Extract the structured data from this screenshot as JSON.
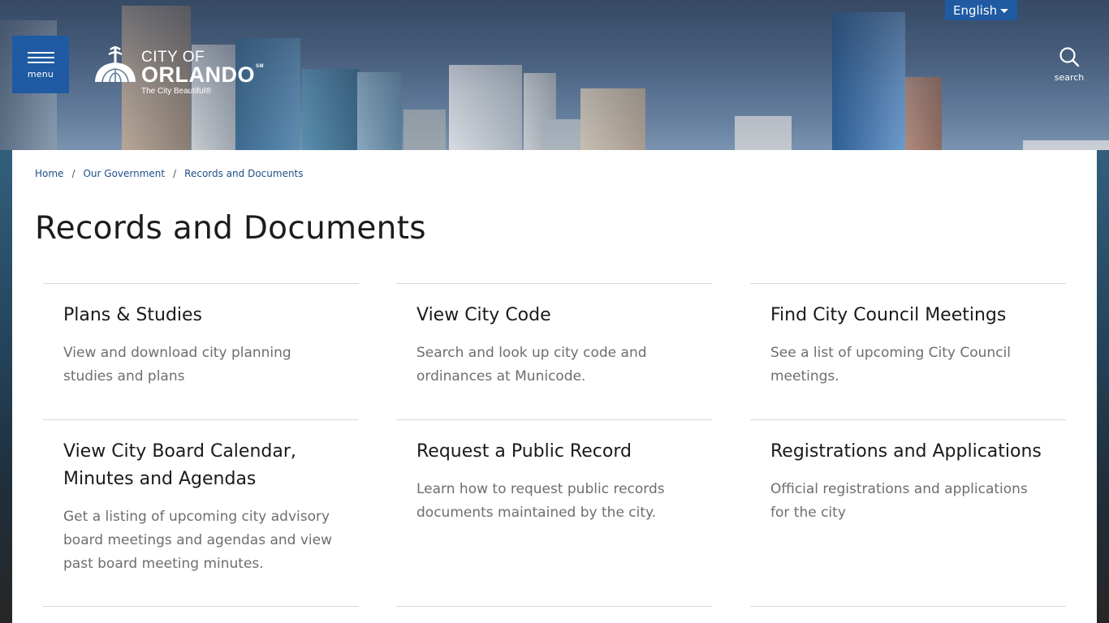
{
  "header": {
    "menu_label": "menu",
    "logo": {
      "city_of": "CITY OF",
      "name": "ORLANDO",
      "service_mark": "SM",
      "tagline": "The City Beautiful®"
    },
    "language": {
      "selected": "English"
    },
    "search_label": "search"
  },
  "breadcrumb": {
    "items": [
      "Home",
      "Our Government",
      "Records and Documents"
    ],
    "separator": "/"
  },
  "page_title": "Records and Documents",
  "cards": [
    {
      "title": "Plans & Studies",
      "description": "View and download city planning studies and plans"
    },
    {
      "title": "View City Code",
      "description": "Search and look up city code and ordinances at Municode."
    },
    {
      "title": "Find City Council Meetings",
      "description": "See a list of upcoming City Council meetings."
    },
    {
      "title": "View City Board Calendar, Minutes and Agendas",
      "description": "Get a listing of upcoming city advisory board meetings and agendas and view past board meeting minutes."
    },
    {
      "title": "Request a Public Record",
      "description": "Learn how to request public records documents maintained by the city."
    },
    {
      "title": "Registrations and Applications",
      "description": "Official registrations and applications for the city"
    }
  ],
  "colors": {
    "brand_blue": "#1f5aa3",
    "link_blue": "#1d4e8a",
    "title_text": "#1c1c1c",
    "desc_text": "#6e6e6e",
    "divider": "#d9d9d9"
  },
  "icons": [
    "hamburger-icon",
    "search-icon",
    "caret-down-icon",
    "city-logo-mark"
  ]
}
